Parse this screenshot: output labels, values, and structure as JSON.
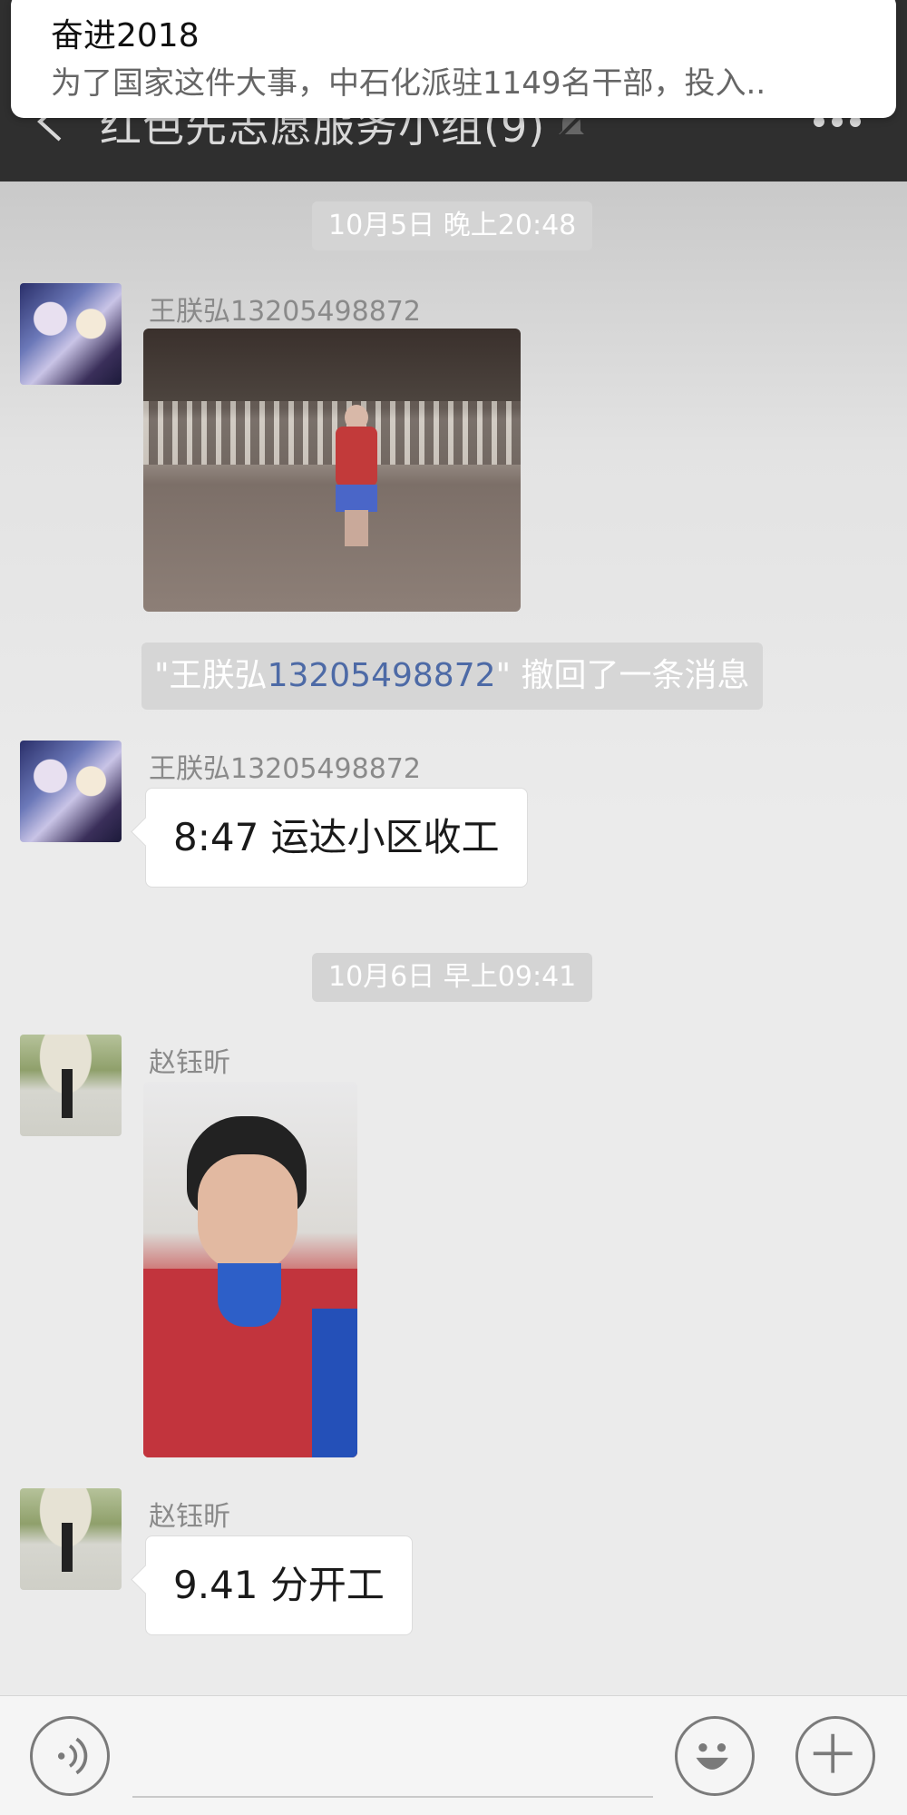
{
  "notification": {
    "title": "奋进2018",
    "body": "为了国家这件大事，中石化派驻1149名干部，投入.."
  },
  "header": {
    "title": "红色先志愿服务小组(9)",
    "back_icon": "chevron-left-icon",
    "mute_icon": "bell-muted-icon",
    "more_icon": "more-dots-icon"
  },
  "messages": {
    "time1": "10月5日 晚上20:48",
    "msg1": {
      "sender": "王朕弘13205498872",
      "type": "image",
      "avatar_icon": "anime-avatar"
    },
    "recall": {
      "prefix": "\"王朕弘",
      "phone": "13205498872",
      "suffix": "\" 撤回了一条消息"
    },
    "msg2": {
      "sender": "王朕弘13205498872",
      "text": "8:47 运达小区收工",
      "avatar_icon": "anime-avatar"
    },
    "time2": "10月6日 早上09:41",
    "msg3": {
      "sender": "赵钰昕",
      "type": "image",
      "avatar_icon": "umbrella-avatar"
    },
    "msg4": {
      "sender": "赵钰昕",
      "text": "9.41 分开工",
      "avatar_icon": "umbrella-avatar"
    }
  },
  "input_bar": {
    "voice_icon": "voice-icon",
    "emoji_icon": "emoji-icon",
    "plus_icon": "plus-icon"
  },
  "colors": {
    "nav_bg": "#2f2f2f",
    "chat_bg": "#ebebeb",
    "link_blue": "#4d6aa6"
  }
}
